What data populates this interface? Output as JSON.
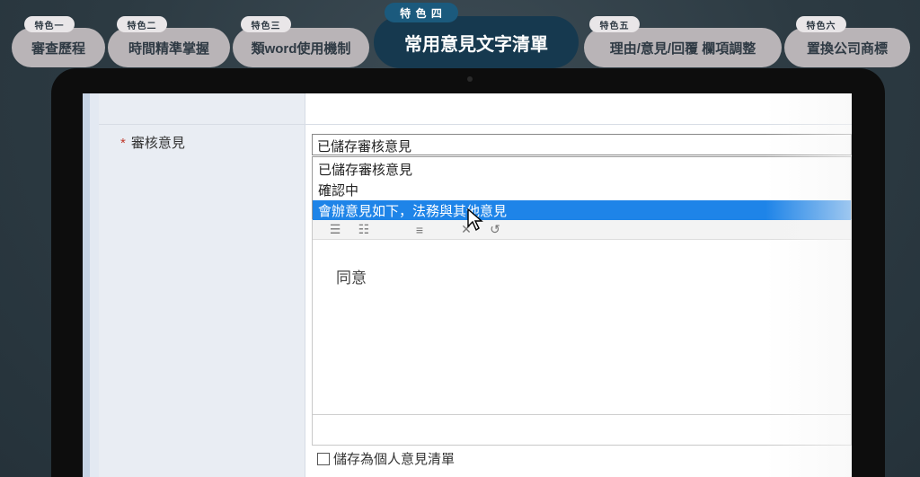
{
  "features": [
    {
      "tag": "特色一",
      "label": "審查歷程"
    },
    {
      "tag": "特色二",
      "label": "時間精準掌握"
    },
    {
      "tag": "特色三",
      "label": "類word使用機制"
    },
    {
      "tag": "特 色 四",
      "label": "常用意見文字清單"
    },
    {
      "tag": "特色五",
      "label": "理由/意見/回覆  欄項調整"
    },
    {
      "tag": "特色六",
      "label": "置換公司商標"
    }
  ],
  "form": {
    "field_label": "審核意見",
    "required_mark": "*",
    "select_value": "已儲存審核意見",
    "options": [
      "已儲存審核意見",
      "確認中",
      "會辦意見如下，法務與其他意見"
    ],
    "selected_index": 2,
    "editor_text": "同意",
    "save_checkbox_label": "儲存為個人意見清單"
  },
  "toolbar_icons": [
    "ordered-list-icon",
    "unordered-list-icon",
    "align-icon",
    "clear-format-icon",
    "undo-icon"
  ],
  "colors": {
    "active_feature_bg": "#16394f",
    "inactive_feature_bg": "#b9b4b7",
    "selection_blue": "#1e84e8"
  }
}
